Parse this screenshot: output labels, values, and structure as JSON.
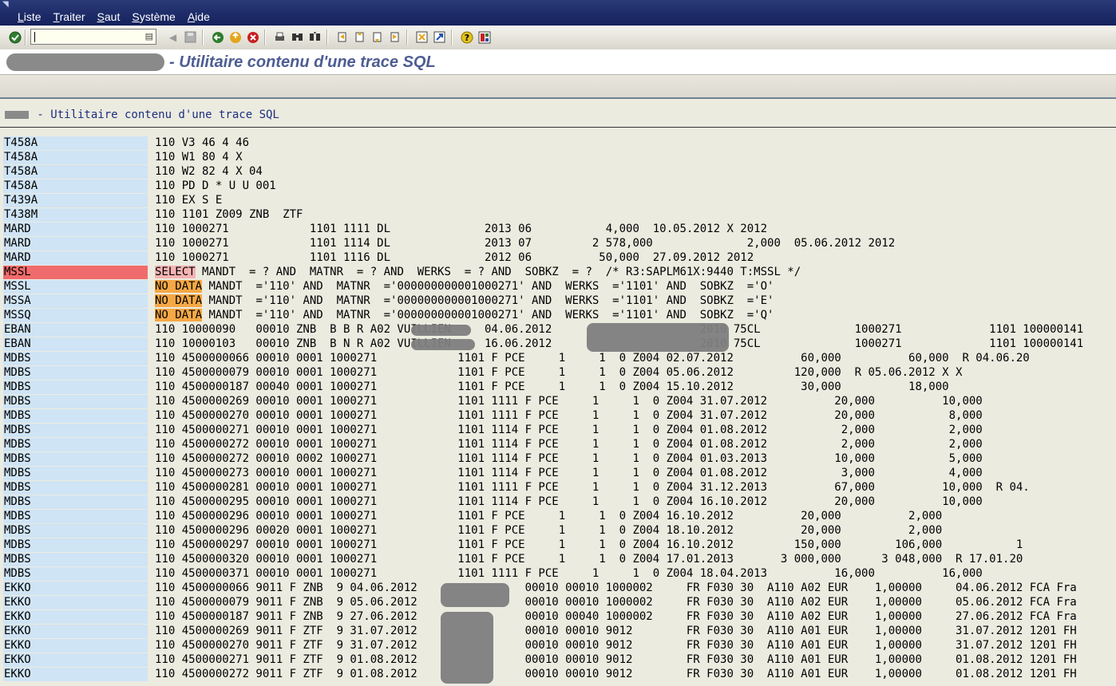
{
  "menu": {
    "items": [
      {
        "ul": "L",
        "rest": "iste"
      },
      {
        "ul": "T",
        "rest": "raiter"
      },
      {
        "ul": "S",
        "rest": "aut"
      },
      {
        "ul": "S",
        "rest": "ystème"
      },
      {
        "ul": "A",
        "rest": "ide"
      }
    ]
  },
  "command_field": {
    "value": ""
  },
  "icons": {
    "enter": "check-icon",
    "back": "back-icon",
    "exit": "exit-icon",
    "cancel": "cancel-icon",
    "print": "print-icon",
    "find": "find-icon",
    "find_next": "find-next-icon",
    "first_page": "first-page-icon",
    "prev_page": "prev-page-icon",
    "next_page": "next-page-icon",
    "last_page": "last-page-icon",
    "new_session": "new-session-icon",
    "shortcut": "shortcut-icon",
    "help": "help-icon",
    "layout": "layout-icon",
    "save": "save-icon"
  },
  "title": {
    "text": "- Utilitaire contenu d'une trace SQL"
  },
  "list_header": {
    "text": " - Utilitaire contenu d'une trace SQL"
  },
  "colors": {
    "table_cell": "#cfe4f5",
    "highlight": "#f06b6b",
    "select_kw": "#f5b3b3",
    "nodata_kw": "#f5a845",
    "title": "#4d5d93"
  },
  "rows": [
    {
      "table": "T458A",
      "text": "110 V3 46 4 46"
    },
    {
      "table": "T458A",
      "text": "110 W1 80 4 X"
    },
    {
      "table": "T458A",
      "text": "110 W2 82 4 X 04"
    },
    {
      "table": "T458A",
      "text": "110 PD D * U U 001"
    },
    {
      "table": "T439A",
      "text": "110 EX S E"
    },
    {
      "table": "T438M",
      "text": "110 1101 Z009 ZNB  ZTF"
    },
    {
      "table": "MARD",
      "text": "110 1000271            1101 1111 DL              2013 06           4,000  10.05.2012 X 2012"
    },
    {
      "table": "MARD",
      "text": "110 1000271            1101 1114 DL              2013 07         2 578,000              2,000  05.06.2012 2012"
    },
    {
      "table": "MARD",
      "text": "110 1000271            1101 1116 DL              2012 06          50,000  27.09.2012 2012"
    },
    {
      "table": "MSSL",
      "highlight": true,
      "kw": "SELECT",
      "text": " MANDT  = ? AND  MATNR  = ? AND  WERKS  = ? AND  SOBKZ  = ?  /* R3:SAPLM61X:9440 T:MSSL */"
    },
    {
      "table": "MSSL",
      "kw2": "NO DATA",
      "text": " MANDT  ='110' AND  MATNR  ='000000000001000271' AND  WERKS  ='1101' AND  SOBKZ  ='O'"
    },
    {
      "table": "MSSA",
      "kw2": "NO DATA",
      "text": " MANDT  ='110' AND  MATNR  ='000000000001000271' AND  WERKS  ='1101' AND  SOBKZ  ='E'"
    },
    {
      "table": "MSSQ",
      "kw2": "NO DATA",
      "text": " MANDT  ='110' AND  MATNR  ='000000000001000271' AND  WERKS  ='1101' AND  SOBKZ  ='Q'"
    },
    {
      "table": "EBAN",
      "text": "110 10000090   00010 ZNB  B B R A02 VUILLIEN     04.06.2012                      2010 75CL              1000271             1101 100000141"
    },
    {
      "table": "EBAN",
      "text": "110 10000103   00010 ZNB  B N R A02 VUILLIEN     16.06.2012                      2010 75CL              1000271             1101 100000141"
    },
    {
      "table": "MDBS",
      "text": "110 4500000066 00010 0001 1000271            1101 F PCE     1     1  0 Z004 02.07.2012          60,000          60,000  R 04.06.20"
    },
    {
      "table": "MDBS",
      "text": "110 4500000079 00010 0001 1000271            1101 F PCE     1     1  0 Z004 05.06.2012         120,000  R 05.06.2012 X X"
    },
    {
      "table": "MDBS",
      "text": "110 4500000187 00040 0001 1000271            1101 F PCE     1     1  0 Z004 15.10.2012          30,000          18,000"
    },
    {
      "table": "MDBS",
      "text": "110 4500000269 00010 0001 1000271            1101 1111 F PCE     1     1  0 Z004 31.07.2012          20,000          10,000"
    },
    {
      "table": "MDBS",
      "text": "110 4500000270 00010 0001 1000271            1101 1111 F PCE     1     1  0 Z004 31.07.2012          20,000           8,000"
    },
    {
      "table": "MDBS",
      "text": "110 4500000271 00010 0001 1000271            1101 1114 F PCE     1     1  0 Z004 01.08.2012           2,000           2,000"
    },
    {
      "table": "MDBS",
      "text": "110 4500000272 00010 0001 1000271            1101 1114 F PCE     1     1  0 Z004 01.08.2012           2,000           2,000"
    },
    {
      "table": "MDBS",
      "text": "110 4500000272 00010 0002 1000271            1101 1114 F PCE     1     1  0 Z004 01.03.2013          10,000           5,000"
    },
    {
      "table": "MDBS",
      "text": "110 4500000273 00010 0001 1000271            1101 1114 F PCE     1     1  0 Z004 01.08.2012           3,000           4,000"
    },
    {
      "table": "MDBS",
      "text": "110 4500000281 00010 0001 1000271            1101 1111 F PCE     1     1  0 Z004 31.12.2013          67,000          10,000  R 04."
    },
    {
      "table": "MDBS",
      "text": "110 4500000295 00010 0001 1000271            1101 1114 F PCE     1     1  0 Z004 16.10.2012          20,000          10,000"
    },
    {
      "table": "MDBS",
      "text": "110 4500000296 00010 0001 1000271            1101 F PCE     1     1  0 Z004 16.10.2012          20,000          2,000"
    },
    {
      "table": "MDBS",
      "text": "110 4500000296 00020 0001 1000271            1101 F PCE     1     1  0 Z004 18.10.2012          20,000          2,000"
    },
    {
      "table": "MDBS",
      "text": "110 4500000297 00010 0001 1000271            1101 F PCE     1     1  0 Z004 16.10.2012         150,000        106,000           1"
    },
    {
      "table": "MDBS",
      "text": "110 4500000320 00010 0001 1000271            1101 F PCE     1     1  0 Z004 17.01.2013       3 000,000      3 048,000  R 17.01.20"
    },
    {
      "table": "MDBS",
      "text": "110 4500000371 00010 0001 1000271            1101 1111 F PCE     1     1  0 Z004 18.04.2013          16,000          16,000"
    },
    {
      "table": "EKKO",
      "text": "110 4500000066 9011 F ZNB  9 04.06.2012                00010 00010 1000002     FR F030 30  A110 A02 EUR    1,00000     04.06.2012 FCA Fra"
    },
    {
      "table": "EKKO",
      "text": "110 4500000079 9011 F ZNB  9 05.06.2012                00010 00010 1000002     FR F030 30  A110 A02 EUR    1,00000     05.06.2012 FCA Fra"
    },
    {
      "table": "EKKO",
      "text": "110 4500000187 9011 F ZNB  9 27.06.2012                00010 00040 1000002     FR F030 30  A110 A02 EUR    1,00000     27.06.2012 FCA Fra"
    },
    {
      "table": "EKKO",
      "text": "110 4500000269 9011 F ZTF  9 31.07.2012                00010 00010 9012        FR F030 30  A110 A01 EUR    1,00000     31.07.2012 1201 FH"
    },
    {
      "table": "EKKO",
      "text": "110 4500000270 9011 F ZTF  9 31.07.2012                00010 00010 9012        FR F030 30  A110 A01 EUR    1,00000     31.07.2012 1201 FH"
    },
    {
      "table": "EKKO",
      "text": "110 4500000271 9011 F ZTF  9 01.08.2012                00010 00010 9012        FR F030 30  A110 A01 EUR    1,00000     01.08.2012 1201 FH"
    },
    {
      "table": "EKKO",
      "text": "110 4500000272 9011 F ZTF  9 01.08.2012                00010 00010 9012        FR F030 30  A110 A01 EUR    1,00000     01.08.2012 1201 FH"
    }
  ]
}
